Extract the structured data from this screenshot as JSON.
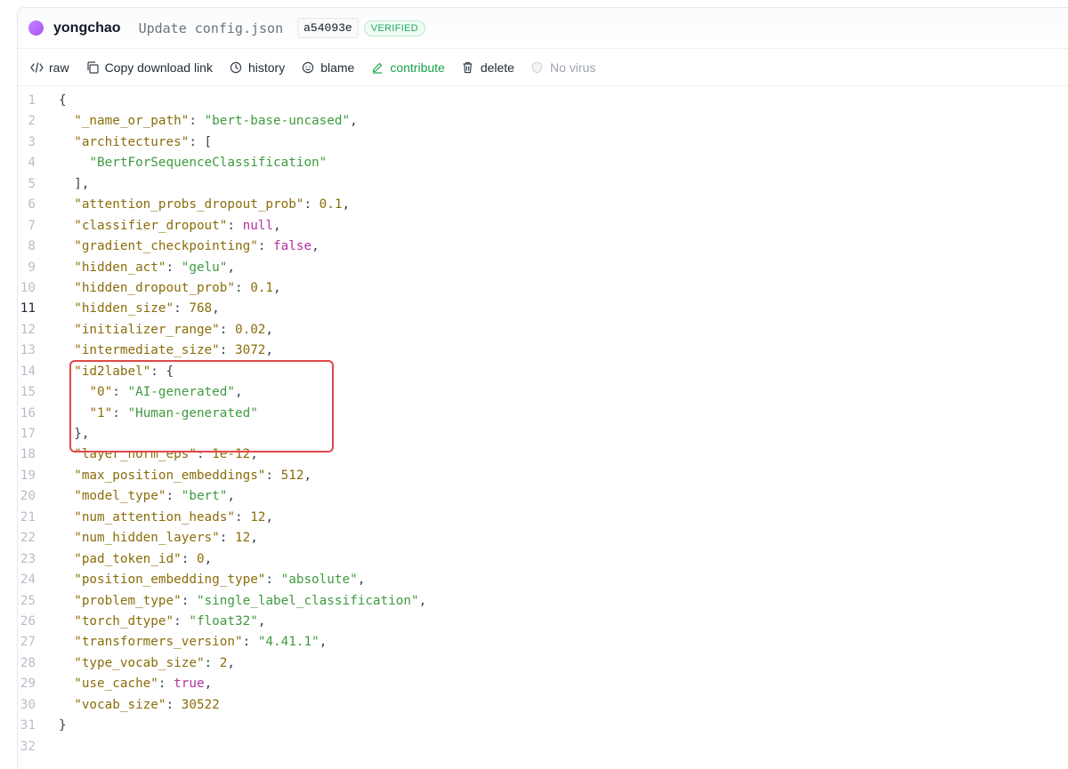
{
  "commit": {
    "author": "yongchao",
    "message": "Update config.json",
    "sha": "a54093e",
    "badge": "VERIFIED"
  },
  "toolbar": {
    "items": [
      {
        "label": "raw",
        "icon": "code-icon"
      },
      {
        "label": "Copy download link",
        "icon": "copy-icon"
      },
      {
        "label": "history",
        "icon": "clock-icon"
      },
      {
        "label": "blame",
        "icon": "smiley-icon"
      },
      {
        "label": "contribute",
        "icon": "pencil-icon"
      },
      {
        "label": "delete",
        "icon": "trash-icon"
      },
      {
        "label": "No virus",
        "icon": "shield-icon"
      }
    ]
  },
  "editor": {
    "active_line": 11,
    "lines": [
      [
        [
          "p",
          "{"
        ]
      ],
      [
        [
          "p",
          "  "
        ],
        [
          "k",
          "\"_name_or_path\""
        ],
        [
          "p",
          ": "
        ],
        [
          "s",
          "\"bert-base-uncased\""
        ],
        [
          "p",
          ","
        ]
      ],
      [
        [
          "p",
          "  "
        ],
        [
          "k",
          "\"architectures\""
        ],
        [
          "p",
          ": ["
        ]
      ],
      [
        [
          "p",
          "    "
        ],
        [
          "s",
          "\"BertForSequenceClassification\""
        ]
      ],
      [
        [
          "p",
          "  ],"
        ]
      ],
      [
        [
          "p",
          "  "
        ],
        [
          "k",
          "\"attention_probs_dropout_prob\""
        ],
        [
          "p",
          ": "
        ],
        [
          "n",
          "0.1"
        ],
        [
          "p",
          ","
        ]
      ],
      [
        [
          "p",
          "  "
        ],
        [
          "k",
          "\"classifier_dropout\""
        ],
        [
          "p",
          ": "
        ],
        [
          "kw",
          "null"
        ],
        [
          "p",
          ","
        ]
      ],
      [
        [
          "p",
          "  "
        ],
        [
          "k",
          "\"gradient_checkpointing\""
        ],
        [
          "p",
          ": "
        ],
        [
          "kw",
          "false"
        ],
        [
          "p",
          ","
        ]
      ],
      [
        [
          "p",
          "  "
        ],
        [
          "k",
          "\"hidden_act\""
        ],
        [
          "p",
          ": "
        ],
        [
          "s",
          "\"gelu\""
        ],
        [
          "p",
          ","
        ]
      ],
      [
        [
          "p",
          "  "
        ],
        [
          "k",
          "\"hidden_dropout_prob\""
        ],
        [
          "p",
          ": "
        ],
        [
          "n",
          "0.1"
        ],
        [
          "p",
          ","
        ]
      ],
      [
        [
          "p",
          "  "
        ],
        [
          "k",
          "\"hidden_size\""
        ],
        [
          "p",
          ": "
        ],
        [
          "n",
          "768"
        ],
        [
          "p",
          ","
        ]
      ],
      [
        [
          "p",
          "  "
        ],
        [
          "k",
          "\"initializer_range\""
        ],
        [
          "p",
          ": "
        ],
        [
          "n",
          "0.02"
        ],
        [
          "p",
          ","
        ]
      ],
      [
        [
          "p",
          "  "
        ],
        [
          "k",
          "\"intermediate_size\""
        ],
        [
          "p",
          ": "
        ],
        [
          "n",
          "3072"
        ],
        [
          "p",
          ","
        ]
      ],
      [
        [
          "p",
          "  "
        ],
        [
          "k",
          "\"id2label\""
        ],
        [
          "p",
          ": {"
        ]
      ],
      [
        [
          "p",
          "    "
        ],
        [
          "k",
          "\"0\""
        ],
        [
          "p",
          ": "
        ],
        [
          "s",
          "\"AI-generated\""
        ],
        [
          "p",
          ","
        ]
      ],
      [
        [
          "p",
          "    "
        ],
        [
          "k",
          "\"1\""
        ],
        [
          "p",
          ": "
        ],
        [
          "s",
          "\"Human-generated\""
        ]
      ],
      [
        [
          "p",
          "  },"
        ]
      ],
      [
        [
          "p",
          "  "
        ],
        [
          "k",
          "\"layer_norm_eps\""
        ],
        [
          "p",
          ": "
        ],
        [
          "n",
          "1e-12"
        ],
        [
          "p",
          ","
        ]
      ],
      [
        [
          "p",
          "  "
        ],
        [
          "k",
          "\"max_position_embeddings\""
        ],
        [
          "p",
          ": "
        ],
        [
          "n",
          "512"
        ],
        [
          "p",
          ","
        ]
      ],
      [
        [
          "p",
          "  "
        ],
        [
          "k",
          "\"model_type\""
        ],
        [
          "p",
          ": "
        ],
        [
          "s",
          "\"bert\""
        ],
        [
          "p",
          ","
        ]
      ],
      [
        [
          "p",
          "  "
        ],
        [
          "k",
          "\"num_attention_heads\""
        ],
        [
          "p",
          ": "
        ],
        [
          "n",
          "12"
        ],
        [
          "p",
          ","
        ]
      ],
      [
        [
          "p",
          "  "
        ],
        [
          "k",
          "\"num_hidden_layers\""
        ],
        [
          "p",
          ": "
        ],
        [
          "n",
          "12"
        ],
        [
          "p",
          ","
        ]
      ],
      [
        [
          "p",
          "  "
        ],
        [
          "k",
          "\"pad_token_id\""
        ],
        [
          "p",
          ": "
        ],
        [
          "n",
          "0"
        ],
        [
          "p",
          ","
        ]
      ],
      [
        [
          "p",
          "  "
        ],
        [
          "k",
          "\"position_embedding_type\""
        ],
        [
          "p",
          ": "
        ],
        [
          "s",
          "\"absolute\""
        ],
        [
          "p",
          ","
        ]
      ],
      [
        [
          "p",
          "  "
        ],
        [
          "k",
          "\"problem_type\""
        ],
        [
          "p",
          ": "
        ],
        [
          "s",
          "\"single_label_classification\""
        ],
        [
          "p",
          ","
        ]
      ],
      [
        [
          "p",
          "  "
        ],
        [
          "k",
          "\"torch_dtype\""
        ],
        [
          "p",
          ": "
        ],
        [
          "s",
          "\"float32\""
        ],
        [
          "p",
          ","
        ]
      ],
      [
        [
          "p",
          "  "
        ],
        [
          "k",
          "\"transformers_version\""
        ],
        [
          "p",
          ": "
        ],
        [
          "s",
          "\"4.41.1\""
        ],
        [
          "p",
          ","
        ]
      ],
      [
        [
          "p",
          "  "
        ],
        [
          "k",
          "\"type_vocab_size\""
        ],
        [
          "p",
          ": "
        ],
        [
          "n",
          "2"
        ],
        [
          "p",
          ","
        ]
      ],
      [
        [
          "p",
          "  "
        ],
        [
          "k",
          "\"use_cache\""
        ],
        [
          "p",
          ": "
        ],
        [
          "kw",
          "true"
        ],
        [
          "p",
          ","
        ]
      ],
      [
        [
          "p",
          "  "
        ],
        [
          "k",
          "\"vocab_size\""
        ],
        [
          "p",
          ": "
        ],
        [
          "n",
          "30522"
        ]
      ],
      [
        [
          "p",
          "}"
        ]
      ],
      []
    ]
  }
}
